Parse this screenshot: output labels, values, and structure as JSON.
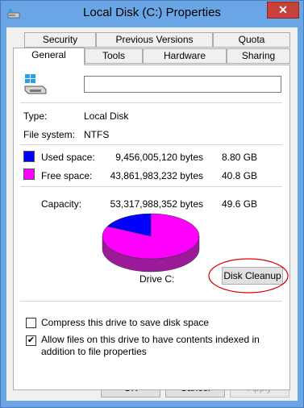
{
  "window": {
    "title": "Local Disk (C:) Properties",
    "close_glyph": "✕"
  },
  "tabs_row1": [
    "Security",
    "Previous Versions",
    "Quota"
  ],
  "tabs_row2": [
    "General",
    "Tools",
    "Hardware",
    "Sharing"
  ],
  "general": {
    "volume_label_value": "",
    "type_label": "Type:",
    "type_value": "Local Disk",
    "fs_label": "File system:",
    "fs_value": "NTFS",
    "used_label": "Used space:",
    "used_bytes": "9,456,005,120 bytes",
    "used_gb": "8.80 GB",
    "free_label": "Free space:",
    "free_bytes": "43,861,983,232 bytes",
    "free_gb": "40.8 GB",
    "capacity_label": "Capacity:",
    "capacity_bytes": "53,317,988,352 bytes",
    "capacity_gb": "49.6 GB",
    "drive_label": "Drive C:",
    "disk_cleanup_label": "Disk Cleanup",
    "compress_label": "Compress this drive to save disk space",
    "compress_checked": false,
    "index_label": "Allow files on this drive to have contents indexed in addition to file properties",
    "index_checked": true
  },
  "colors": {
    "used": "#0000ff",
    "free": "#ff00ff",
    "highlight": "#e00000"
  },
  "buttons": {
    "ok": "OK",
    "cancel": "Cancel",
    "apply": "Apply"
  },
  "pie": {
    "used_fraction": 0.1773,
    "free_fraction": 0.8227
  }
}
